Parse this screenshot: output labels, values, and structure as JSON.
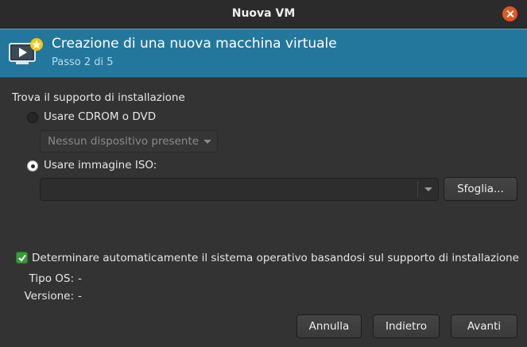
{
  "window": {
    "title": "Nuova VM"
  },
  "banner": {
    "heading": "Creazione di una nuova macchina virtuale",
    "step": "Passo 2 di 5"
  },
  "install": {
    "section_label": "Trova il supporto di installazione",
    "cdrom_option": "Usare CDROM o DVD",
    "cdrom_device": "Nessun dispositivo presente",
    "iso_option": "Usare immagine ISO:",
    "iso_path": "",
    "browse_label": "Sfoglia..."
  },
  "os_detect": {
    "auto_label": "Determinare automaticamente il sistema operativo basandosi sul supporto di installazione",
    "auto_checked": true,
    "os_type_key": "Tipo OS:",
    "os_type_value": "-",
    "version_key": "Versione:",
    "version_value": "-"
  },
  "footer": {
    "cancel": "Annulla",
    "back": "Indietro",
    "forward": "Avanti"
  },
  "selected_option": "iso",
  "colors": {
    "banner": "#24779c",
    "close": "#e4551f",
    "check": "#3b9a3b"
  },
  "icons": [
    "close-icon",
    "new-vm-icon",
    "dropdown-arrow-icon",
    "checkmark-icon"
  ]
}
